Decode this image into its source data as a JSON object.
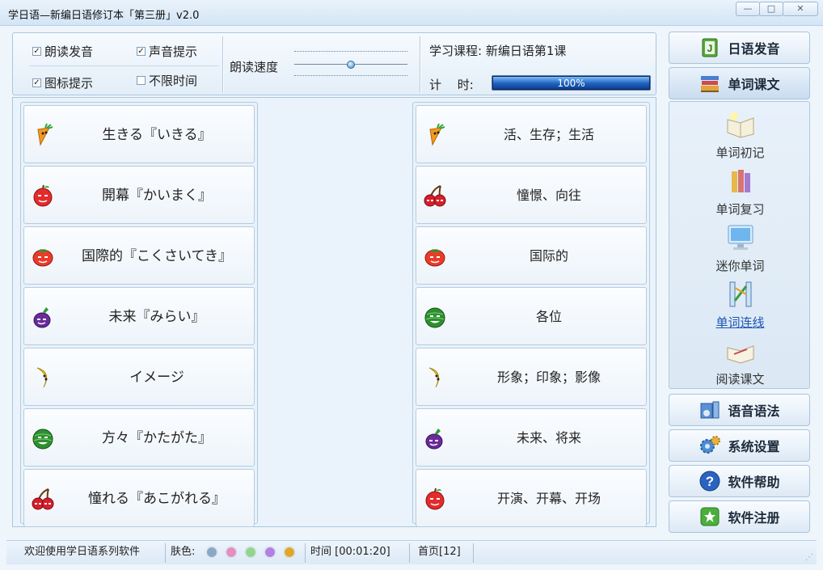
{
  "window": {
    "title": "学日语—新编日语修订本「第三册」v2.0",
    "controls": {
      "minimize": "—",
      "maximize": "□",
      "close": "✕"
    }
  },
  "toolbar": {
    "options": [
      {
        "label": "朗读发音",
        "checked": true
      },
      {
        "label": "声音提示",
        "checked": true
      },
      {
        "label": "图标提示",
        "checked": true
      },
      {
        "label": "不限时间",
        "checked": false
      }
    ],
    "speed_label": "朗读速度",
    "speed_level": 0.5,
    "course_label": "学习课程: 新编日语第1课",
    "timer_label": "计　 时:",
    "timer_progress": 100,
    "timer_progress_text": "100%"
  },
  "board": {
    "left_items": [
      {
        "icon": "carrot-icon",
        "text": "生きる『いきる』"
      },
      {
        "icon": "apple-icon",
        "text": "開幕『かいまく』"
      },
      {
        "icon": "tomato-icon",
        "text": "国際的『こくさいてき』"
      },
      {
        "icon": "eggplant-icon",
        "text": "未来『みらい』"
      },
      {
        "icon": "banana-icon",
        "text": "イメージ"
      },
      {
        "icon": "watermelon-icon",
        "text": "方々『かたがた』"
      },
      {
        "icon": "cherry-icon",
        "text": "憧れる『あこがれる』"
      }
    ],
    "right_items": [
      {
        "icon": "carrot-icon",
        "text": "活、生存；生活"
      },
      {
        "icon": "cherry-icon",
        "text": "憧憬、向往"
      },
      {
        "icon": "tomato-icon",
        "text": "国际的"
      },
      {
        "icon": "watermelon-icon",
        "text": "各位"
      },
      {
        "icon": "banana-icon",
        "text": "形象；印象；影像"
      },
      {
        "icon": "eggplant-icon",
        "text": "未来、将来"
      },
      {
        "icon": "apple-icon",
        "text": "开演、开幕、开场"
      }
    ]
  },
  "sidebar": {
    "pronunciation": "日语发音",
    "vocab_text": "单词课文",
    "sub_items": [
      {
        "icon": "book-open-icon",
        "label": "单词初记"
      },
      {
        "icon": "books-icon",
        "label": "单词复习"
      },
      {
        "icon": "monitor-icon",
        "label": "迷你单词"
      },
      {
        "icon": "connect-lines-icon",
        "label": "单词连线"
      },
      {
        "icon": "reading-book-icon",
        "label": "阅读课文"
      }
    ],
    "grammar": "语音语法",
    "settings": "系统设置",
    "help": "软件帮助",
    "register": "软件注册"
  },
  "status": {
    "welcome": "欢迎使用学日语系列软件",
    "skin_label": "肤色:",
    "skin_colors": [
      "#8aa7c4",
      "#e58fbf",
      "#93d58a",
      "#b57fe0",
      "#e0a82a"
    ],
    "time": "时间 [00:01:20]",
    "page": "首页[12]"
  }
}
